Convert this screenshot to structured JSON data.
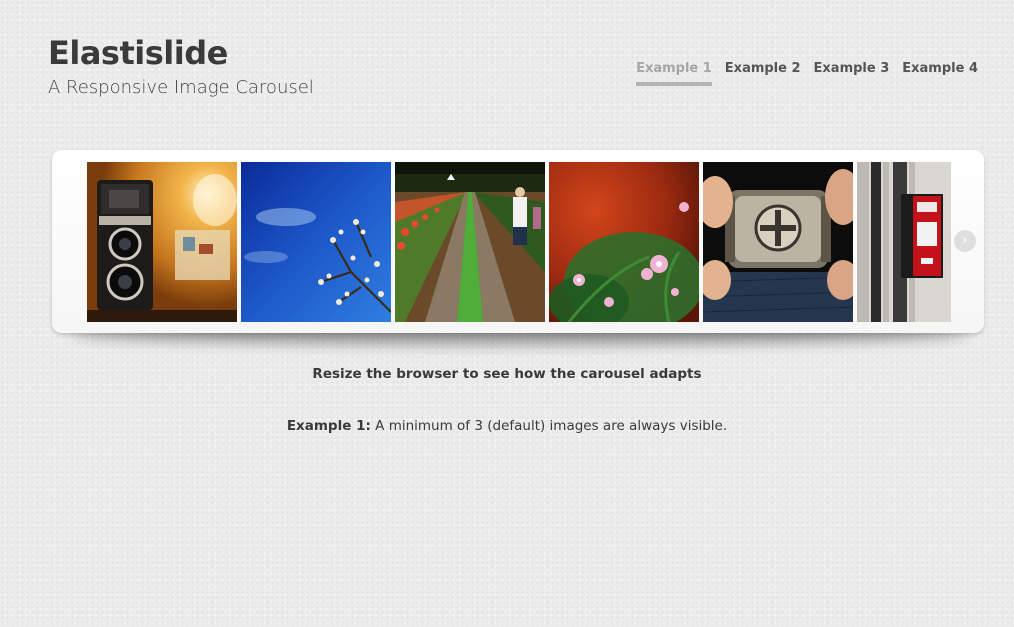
{
  "header": {
    "title": "Elastislide",
    "subtitle": "A Responsive Image Carousel"
  },
  "nav": {
    "items": [
      {
        "label": "Example 1",
        "active": true
      },
      {
        "label": "Example 2",
        "active": false
      },
      {
        "label": "Example 3",
        "active": false
      },
      {
        "label": "Example 4",
        "active": false
      }
    ]
  },
  "carousel": {
    "thumbnails": [
      {
        "icon": "camera-photo"
      },
      {
        "icon": "sky-flowers-photo"
      },
      {
        "icon": "garden-path-photo"
      },
      {
        "icon": "pink-flowers-photo"
      },
      {
        "icon": "buckle-photo"
      },
      {
        "icon": "fire-alarm-photo"
      }
    ],
    "next_arrow": "›"
  },
  "hint": "Resize the browser to see how the carousel adapts",
  "description": {
    "label": "Example 1:",
    "text": " A minimum of 3 (default) images are always visible."
  }
}
